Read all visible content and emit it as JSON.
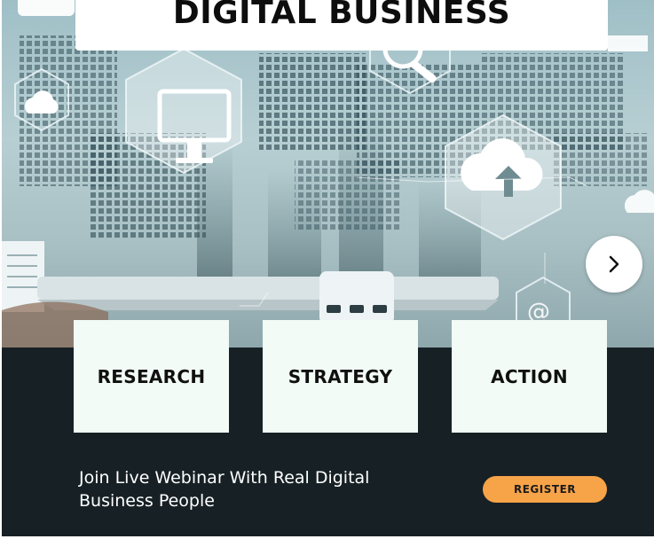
{
  "hero": {
    "title": "DIGITAL BUSINESS",
    "image_icon": "digital-business-network-illustration",
    "next_icon": "chevron-right-icon"
  },
  "cards": [
    {
      "label": "RESEARCH"
    },
    {
      "label": "STRATEGY"
    },
    {
      "label": "ACTION"
    }
  ],
  "webinar": {
    "line1": "Join Live Webinar With Real Digital",
    "line2": "Business People"
  },
  "register": {
    "label": "REGISTER"
  },
  "colors": {
    "panel": "#172125",
    "card": "#f2fbf6",
    "accent": "#f7a348"
  }
}
